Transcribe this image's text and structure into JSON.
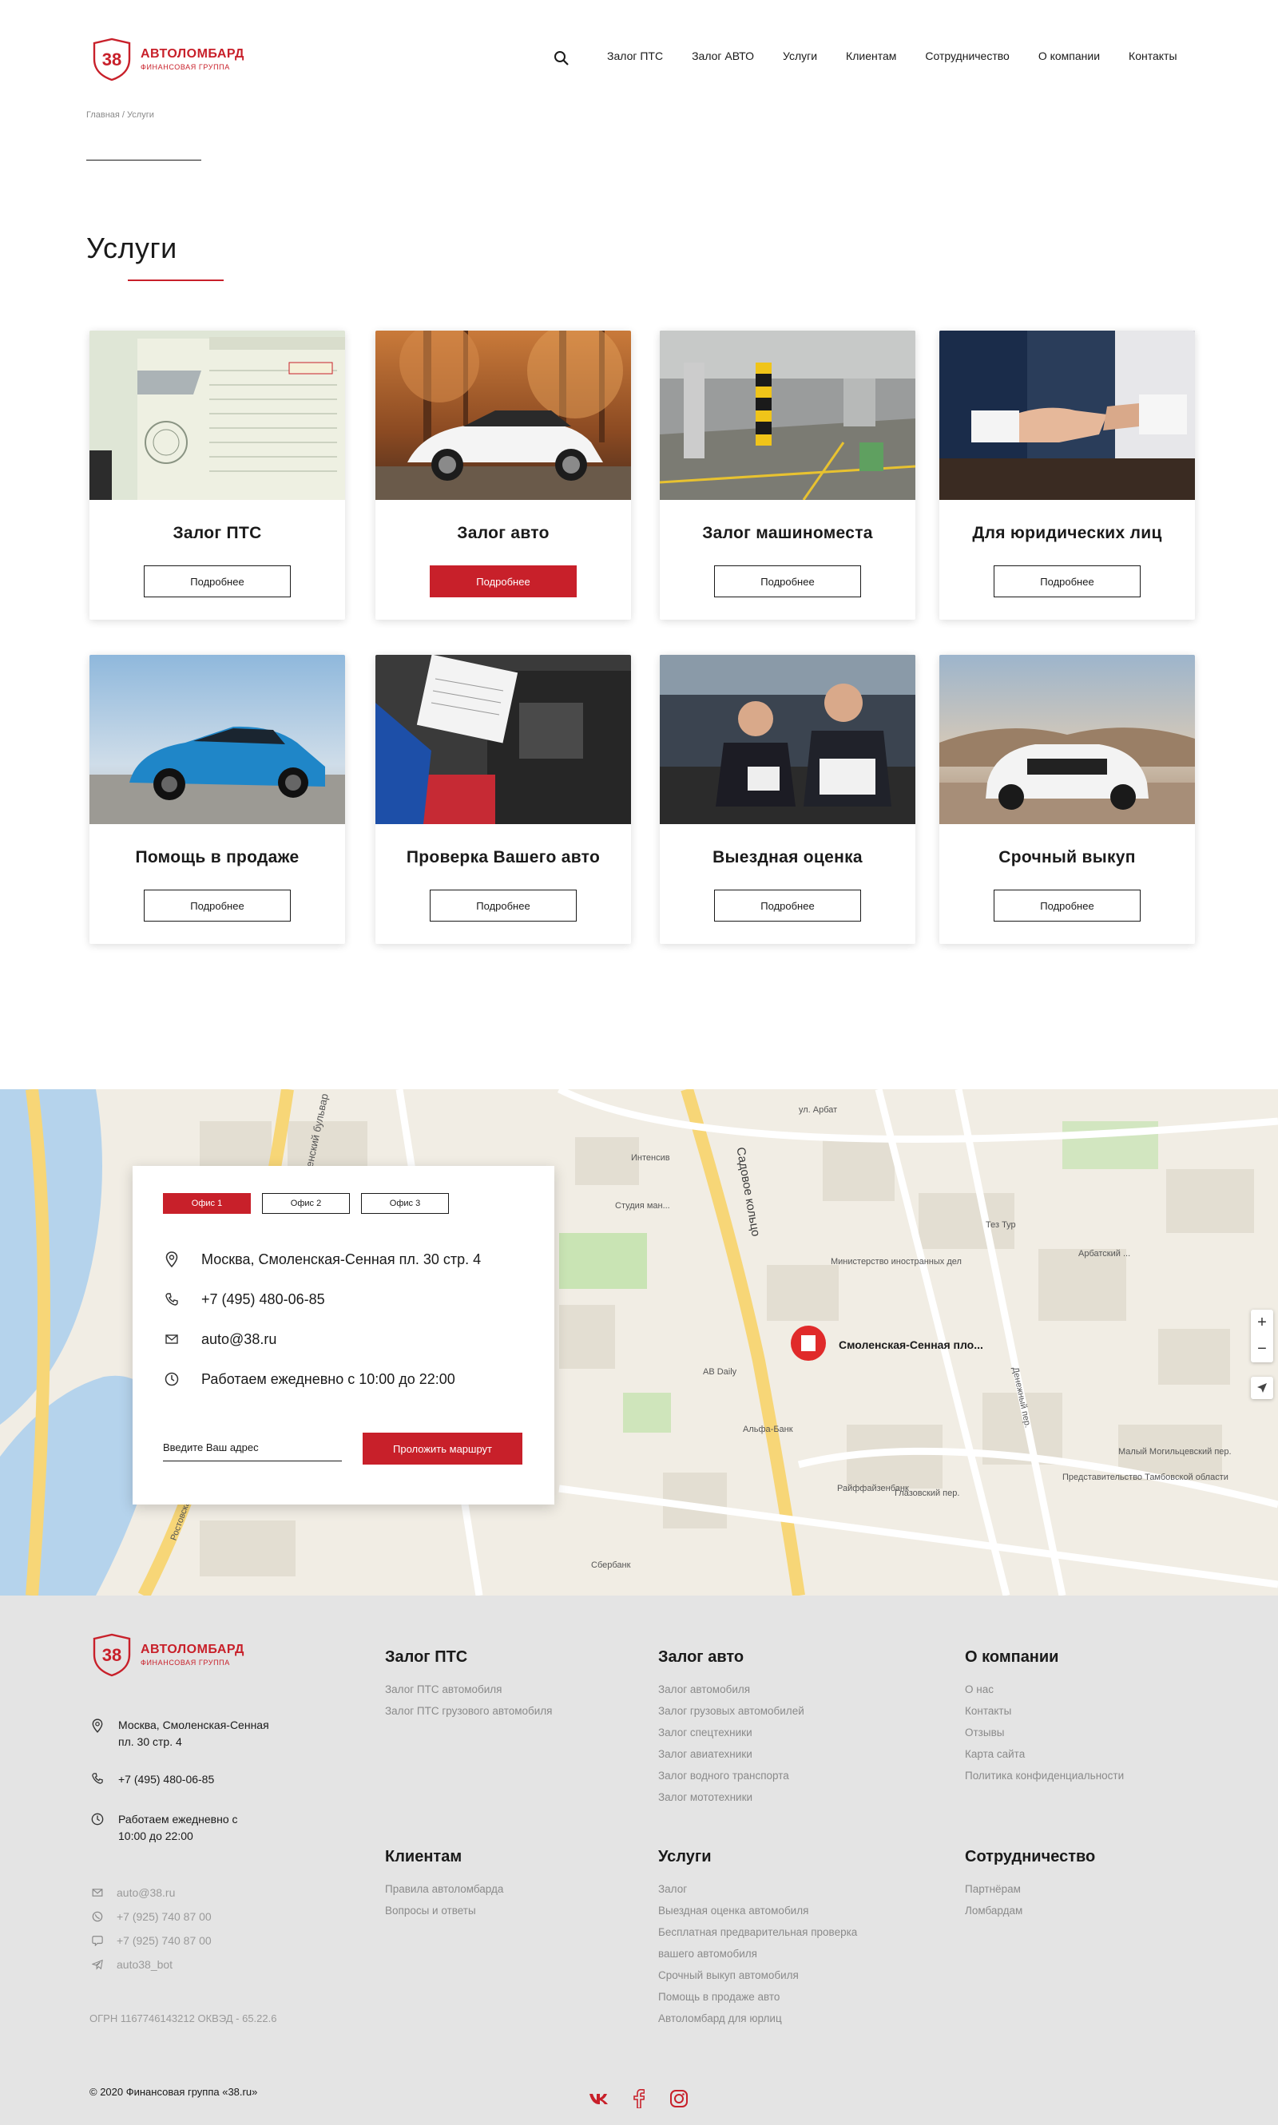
{
  "brand": {
    "title": "АВТОЛОМБАРД",
    "subtitle": "ФИНАНСОВАЯ ГРУППА",
    "accent_color": "#c8202a"
  },
  "nav": {
    "items": [
      "Залог ПТС",
      "Залог АВТО",
      "Услуги",
      "Клиентам",
      "Сотрудничество",
      "О компании",
      "Контакты"
    ]
  },
  "breadcrumb": {
    "home": "Главная",
    "separator": " / ",
    "current": "Услуги"
  },
  "page": {
    "title": "Услуги"
  },
  "services": {
    "button_label": "Подробнее",
    "items": [
      {
        "title": "Залог ПТС",
        "image": "vehicle-passport-photo",
        "active": false
      },
      {
        "title": "Залог авто",
        "image": "white-bmw-photo",
        "active": true
      },
      {
        "title": "Залог машиноместа",
        "image": "parking-garage-photo",
        "active": false
      },
      {
        "title": "Для юридических лиц",
        "image": "handshake-photo",
        "active": false
      },
      {
        "title": "Помощь в продаже",
        "image": "blue-bmw-photo",
        "active": false
      },
      {
        "title": "Проверка Вашего авто",
        "image": "car-inspection-photo",
        "active": false
      },
      {
        "title": "Выездная оценка",
        "image": "onsite-evaluation-photo",
        "active": false
      },
      {
        "title": "Срочный выкуп",
        "image": "white-mercedes-photo",
        "active": false
      }
    ]
  },
  "office": {
    "tabs": [
      "Офис 1",
      "Офис 2",
      "Офис 3"
    ],
    "active_tab": 0,
    "address": "Москва, Смоленская-Сенная пл. 30 стр. 4",
    "phone": "+7 (495) 480-06-85",
    "email": "auto@38.ru",
    "hours": "Работаем ежедневно с 10:00 до 22:00",
    "address_placeholder": "Введите Ваш адрес",
    "route_button": "Проложить маршрут"
  },
  "map": {
    "marker_label": "Смоленская-Сенная пло...",
    "labels": [
      "Садовое кольцо",
      "Смоленский бульвар",
      "Денежный пер.",
      "Глазовский пер.",
      "Малый Могильцевский пер.",
      "Министерство иностранных дел",
      "Интенсив",
      "Студия ман...",
      "Арбатский ...",
      "Тез Тур",
      "Альфа-Банк",
      "Райффайзенбанк",
      "Представительство Тамбовской области",
      "AB Daily",
      "ул. Арбат",
      "Ростовская наб.",
      "Сбербанк"
    ],
    "zoom_in": "+",
    "zoom_out": "−"
  },
  "footer": {
    "address": "Москва, Смоленская-Сенная пл. 30 стр. 4",
    "phone": "+7 (495) 480-06-85",
    "hours": "Работаем ежедневно с 10:00 до 22:00",
    "email": "auto@38.ru",
    "whatsapp": "+7 (925) 740 87 00",
    "viber": "+7 (925) 740 87 00",
    "telegram": "auto38_bot",
    "ogrn": "ОГРН 1167746143212 ОКВЭД - 65.22.6",
    "copyright": "© 2020 Финансовая группа «38.ru»",
    "columns": [
      {
        "title": "Залог ПТС",
        "links": [
          "Залог ПТС автомобиля",
          "Залог ПТС грузового автомобиля"
        ]
      },
      {
        "title": "Залог авто",
        "links": [
          "Залог автомобиля",
          "Залог грузовых автомобилей",
          "Залог спецтехники",
          "Залог авиатехники",
          "Залог водного транспорта",
          "Залог мототехники"
        ]
      },
      {
        "title": "О компании",
        "links": [
          "О нас",
          "Контакты",
          "Отзывы",
          "Карта сайта",
          "Политика конфиденциальности"
        ]
      },
      {
        "title": "Клиентам",
        "links": [
          "Правила автоломбарда",
          "Вопросы и ответы"
        ]
      },
      {
        "title": "Услуги",
        "links": [
          "Залог",
          "Выездная оценка автомобиля",
          "Бесплатная предварительная проверка",
          "вашего автомобиля",
          "Срочный выкуп автомобиля",
          "Помощь в продаже авто",
          "Автоломбард для юрлиц"
        ]
      },
      {
        "title": "Сотрудничество",
        "links": [
          "Партнёрам",
          "Ломбардам"
        ]
      }
    ],
    "socials": [
      "vk-icon",
      "facebook-icon",
      "instagram-icon"
    ]
  }
}
